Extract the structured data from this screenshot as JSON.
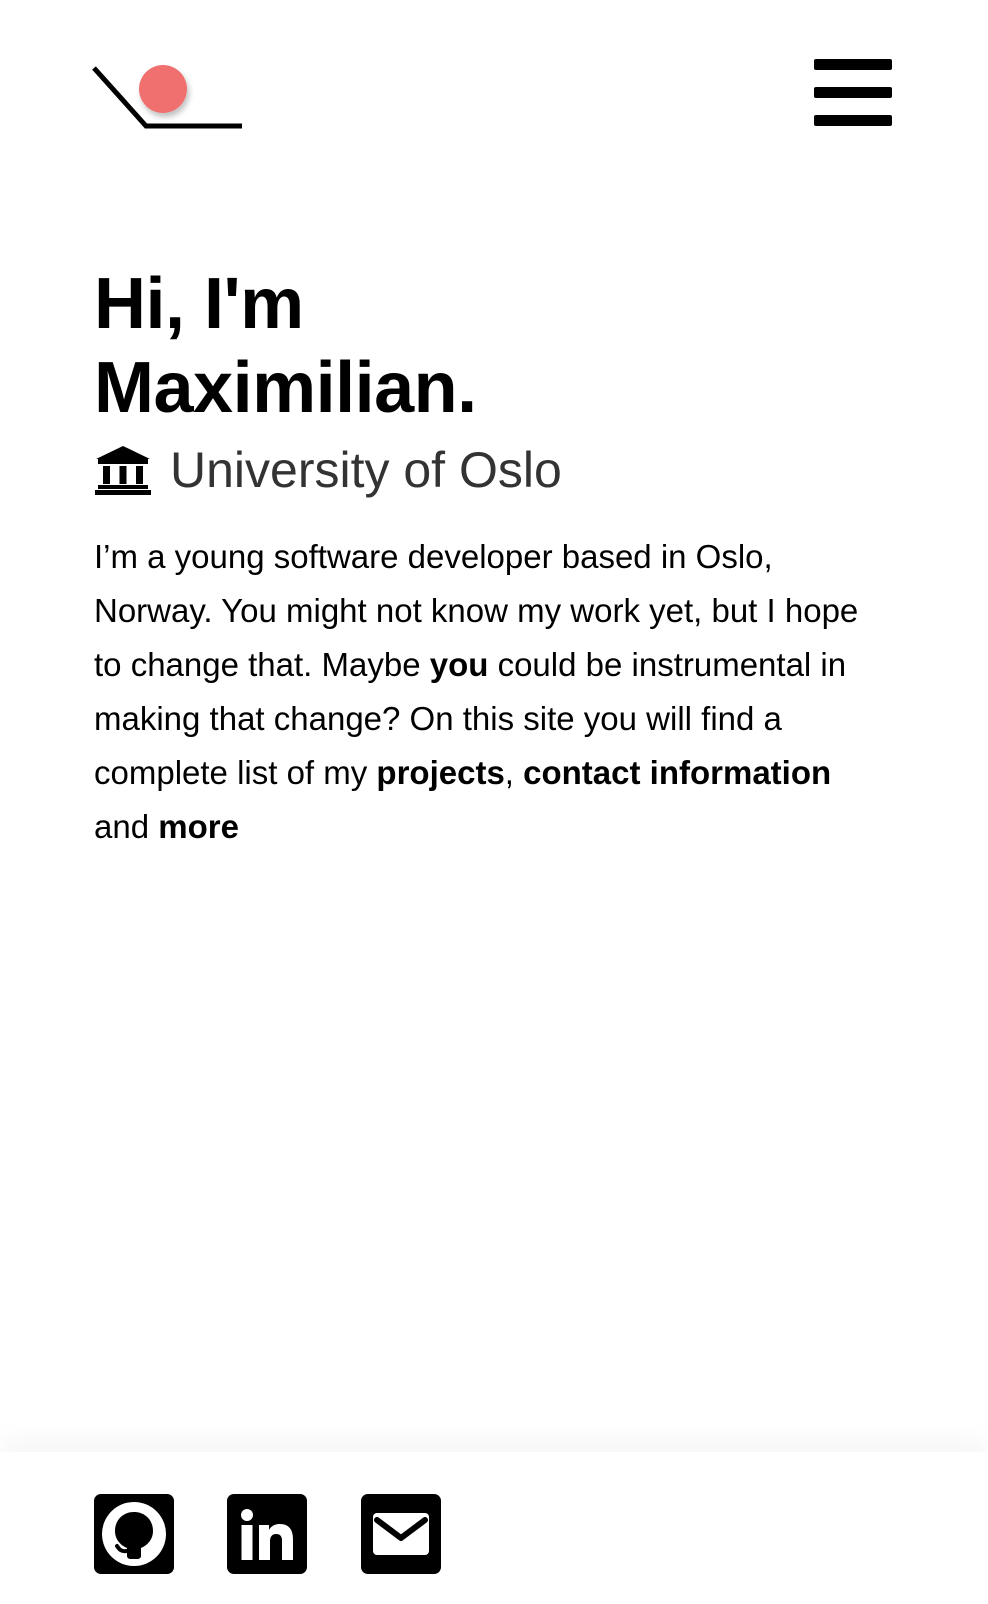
{
  "header": {
    "logo_icon": "logo-slope-ball-icon",
    "logo_accent_color": "#F07070",
    "menu_icon": "hamburger-menu-icon"
  },
  "hero": {
    "title_line1": "Hi, I'm",
    "title_line2": "Maximilian.",
    "affiliation_icon": "institution-icon",
    "affiliation": "University of Oslo"
  },
  "bio": {
    "part1": "I’m a young software developer based in Oslo, Norway. You might not know my work yet, but I hope to change that. Maybe ",
    "you": "you",
    "part2": " could be instrumental in making that change? On this site you will find a complete list of my ",
    "projects_link": "projects",
    "part3": ", ",
    "contact_link": "contact information",
    "part4": " and ",
    "more_link": "more"
  },
  "footer": {
    "social": [
      {
        "icon": "github-icon"
      },
      {
        "icon": "linkedin-icon"
      },
      {
        "icon": "mail-icon"
      }
    ]
  }
}
